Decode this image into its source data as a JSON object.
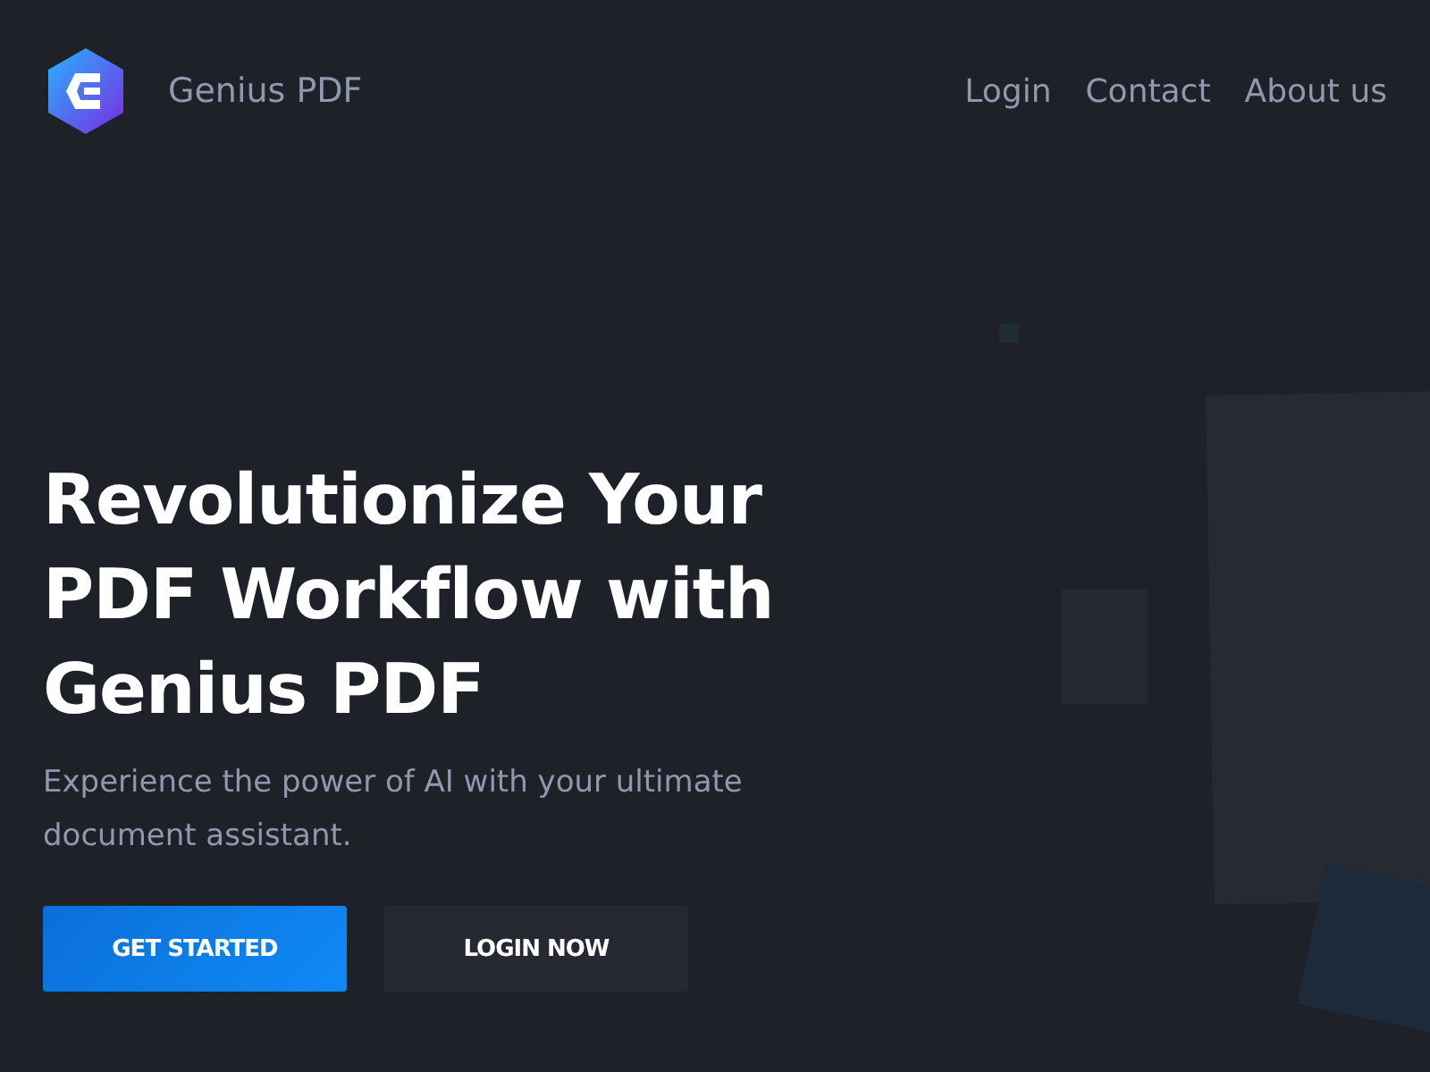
{
  "header": {
    "brand": "Genius PDF",
    "nav": [
      "Login",
      "Contact",
      "About us"
    ]
  },
  "hero": {
    "title": "Revolutionize Your PDF Workflow with Genius PDF",
    "subtitle": "Experience the power of AI with your ultimate document assistant.",
    "buttons": [
      {
        "label": "GET STARTED",
        "kind": "primary"
      },
      {
        "label": "LOGIN NOW",
        "kind": "secondary"
      }
    ]
  }
}
